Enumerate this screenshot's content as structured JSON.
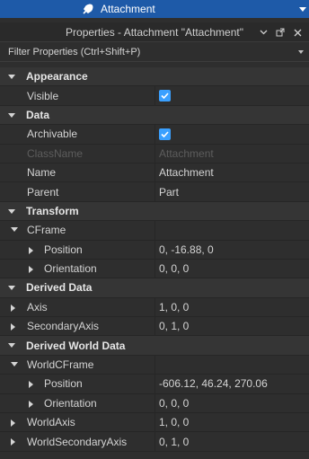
{
  "explorer": {
    "selected_label": "Attachment"
  },
  "panel": {
    "title": "Properties - Attachment \"Attachment\"",
    "filter_placeholder": "Filter Properties (Ctrl+Shift+P)"
  },
  "sections": {
    "appearance": {
      "label": "Appearance",
      "visible": {
        "name": "Visible",
        "checked": true
      }
    },
    "data": {
      "label": "Data",
      "archivable": {
        "name": "Archivable",
        "checked": true
      },
      "classname": {
        "name": "ClassName",
        "value": "Attachment"
      },
      "name": {
        "name": "Name",
        "value": "Attachment"
      },
      "parent": {
        "name": "Parent",
        "value": "Part"
      }
    },
    "transform": {
      "label": "Transform",
      "cframe": {
        "name": "CFrame"
      },
      "position": {
        "name": "Position",
        "value": "0, -16.88, 0"
      },
      "orientation": {
        "name": "Orientation",
        "value": "0, 0, 0"
      }
    },
    "derived": {
      "label": "Derived Data",
      "axis": {
        "name": "Axis",
        "value": "1, 0, 0"
      },
      "secondary": {
        "name": "SecondaryAxis",
        "value": "0, 1, 0"
      }
    },
    "derived_world": {
      "label": "Derived World Data",
      "worldcframe": {
        "name": "WorldCFrame"
      },
      "position": {
        "name": "Position",
        "value": "-606.12, 46.24, 270.06"
      },
      "orientation": {
        "name": "Orientation",
        "value": "0, 0, 0"
      },
      "worldaxis": {
        "name": "WorldAxis",
        "value": "1, 0, 0"
      },
      "worldsecondary": {
        "name": "WorldSecondaryAxis",
        "value": "0, 1, 0"
      }
    }
  },
  "colors": {
    "accent": "#1e5aa8",
    "checkbox": "#3aa0ff",
    "panel_bg": "#2e2e2e",
    "section_bg": "#353535"
  }
}
